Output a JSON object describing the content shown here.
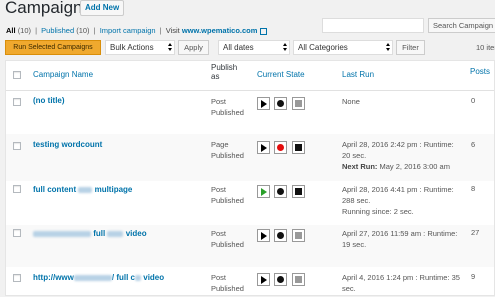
{
  "header": {
    "title": "Campaigns",
    "add_new": "Add New"
  },
  "filters": {
    "all_label": "All",
    "all_count": "(10)",
    "published_label": "Published",
    "published_count": "(10)",
    "import_label": "Import campaign",
    "visit_label": "Visit",
    "site_label": "www.wpematico.com"
  },
  "search": {
    "placeholder": "",
    "button": "Search Campaign"
  },
  "toolbar": {
    "run_selected": "Run Selected Campaigns",
    "bulk_actions": "Bulk Actions",
    "apply": "Apply",
    "dates": "All dates",
    "categories": "All Categories",
    "filter": "Filter",
    "items_count": "10 item"
  },
  "table": {
    "columns": {
      "name": "Campaign Name",
      "publish_as_1": "Publish",
      "publish_as_2": "as",
      "state": "Current State",
      "last_run": "Last Run",
      "posts": "Posts"
    },
    "rows": [
      {
        "name": "(no title)",
        "publish_1": "Post",
        "publish_2": "Published",
        "state": "stopped",
        "run_1": "None",
        "run_2": "",
        "run_3": "",
        "posts": "0"
      },
      {
        "name": "testing wordcount",
        "publish_1": "Page",
        "publish_2": "Published",
        "state": "scheduled",
        "run_1": "April 28, 2016 2:42 pm : Runtime:",
        "run_2": "20 sec.",
        "run_3_label": "Next Run:",
        "run_3": " May 2, 2016 3:00 am",
        "posts": "6"
      },
      {
        "name_a": "full content",
        "name_b": "multipage",
        "publish_1": "Post",
        "publish_2": "Published",
        "state": "running",
        "run_1": "April 28, 2016 4:41 pm : Runtime:",
        "run_2": "288 sec.",
        "run_3": "Running since: 2 sec.",
        "posts": "8"
      },
      {
        "name_a": "full",
        "name_b": "video",
        "publish_1": "Post",
        "publish_2": "Published",
        "state": "stopped",
        "run_1": "April 27, 2016 11:59 am : Runtime:",
        "run_2": "19 sec.",
        "posts": "27"
      },
      {
        "name_a": "http://www",
        "name_b": "/ full c",
        "name_c": "video",
        "publish_1": "Post",
        "publish_2": "Published",
        "state": "stopped",
        "run_1": "April 4, 2016 1:24 pm : Runtime: 35",
        "run_2": "sec.",
        "posts": "9"
      }
    ]
  },
  "colors": {
    "link": "#0073aa",
    "run_button": "#f0a92e",
    "play_active": "#2aa02a",
    "record_active": "#e40d0d"
  }
}
